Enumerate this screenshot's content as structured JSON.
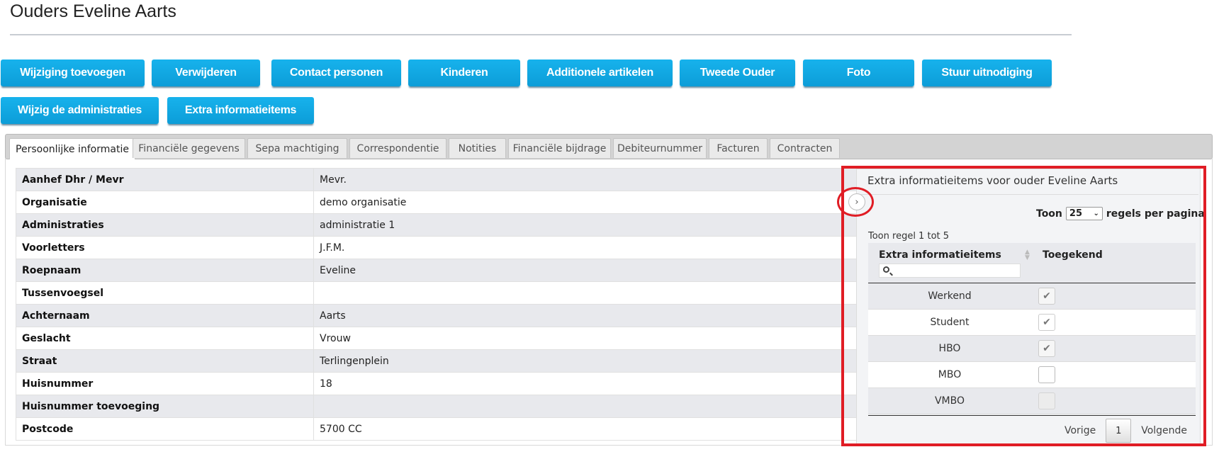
{
  "page": {
    "title": "Ouders Eveline Aarts"
  },
  "buttons_row1": [
    "Wijziging toevoegen",
    "Verwijderen",
    "Contact personen",
    "Kinderen",
    "Additionele artikelen",
    "Tweede Ouder",
    "Foto",
    "Stuur uitnodiging"
  ],
  "buttons_row2": [
    "Wijzig de administraties",
    "Extra informatieitems"
  ],
  "tabs": [
    "Persoonlijke informatie",
    "Financiële gegevens",
    "Sepa machtiging",
    "Correspondentie",
    "Notities",
    "Financiële bijdrage",
    "Debiteurnummer",
    "Facturen",
    "Contracten"
  ],
  "active_tab": "Persoonlijke informatie",
  "info_rows": [
    {
      "label": "Aanhef Dhr / Mevr",
      "value": "Mevr."
    },
    {
      "label": "Organisatie",
      "value": "demo organisatie"
    },
    {
      "label": "Administraties",
      "value": "administratie 1"
    },
    {
      "label": "Voorletters",
      "value": "J.F.M."
    },
    {
      "label": "Roepnaam",
      "value": "Eveline"
    },
    {
      "label": "Tussenvoegsel",
      "value": ""
    },
    {
      "label": "Achternaam",
      "value": "Aarts"
    },
    {
      "label": "Geslacht",
      "value": "Vrouw"
    },
    {
      "label": "Straat",
      "value": "Terlingenplein"
    },
    {
      "label": "Huisnummer",
      "value": "18"
    },
    {
      "label": "Huisnummer toevoeging",
      "value": ""
    },
    {
      "label": "Postcode",
      "value": "5700 CC"
    }
  ],
  "extra_panel": {
    "title": "Extra informatieitems voor ouder Eveline Aarts",
    "toggle_icon": "chevron-right-icon",
    "length": {
      "prefix": "Toon",
      "selected": "25",
      "suffix": "regels per pagina"
    },
    "range_text": "Toon regel 1 tot 5",
    "columns": [
      "Extra informatieitems",
      "Toegekend"
    ],
    "search_placeholder": "",
    "items": [
      {
        "name": "Werkend",
        "checked": true,
        "enabled": false
      },
      {
        "name": "Student",
        "checked": true,
        "enabled": true
      },
      {
        "name": "HBO",
        "checked": true,
        "enabled": false
      },
      {
        "name": "MBO",
        "checked": false,
        "enabled": true
      },
      {
        "name": "VMBO",
        "checked": false,
        "enabled": false
      }
    ],
    "pager": {
      "prev": "Vorige",
      "page": "1",
      "next": "Volgende"
    }
  },
  "colors": {
    "button": "#0c9dd8",
    "highlight": "#e01d25",
    "tabbar": "#d3d3d3"
  }
}
